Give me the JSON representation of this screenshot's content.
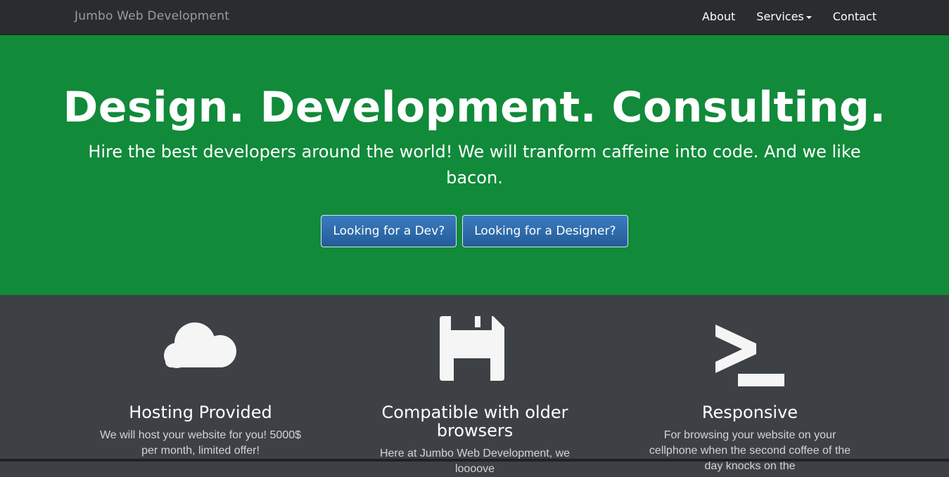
{
  "nav": {
    "brand": "Jumbo Web Development",
    "links": [
      {
        "label": "About"
      },
      {
        "label": "Services"
      },
      {
        "label": "Contact"
      }
    ]
  },
  "hero": {
    "title": "Design. Development. Consulting.",
    "subtitle": "Hire the best developers around the world! We will tranform caffeine into code. And we like bacon.",
    "buttons": [
      {
        "label": "Looking for a Dev?"
      },
      {
        "label": "Looking for a Designer?"
      }
    ]
  },
  "features": [
    {
      "icon": "cloud-icon",
      "title": "Hosting Provided",
      "text": "We will host your website for you! 5000$ per month, limited offer!"
    },
    {
      "icon": "floppy-disk-icon",
      "title": "Compatible with older browsers",
      "text": "Here at Jumbo Web Development, we loooove"
    },
    {
      "icon": "terminal-icon",
      "title": "Responsive",
      "text": "For browsing your website on your cellphone when the second coffee of the day knocks on the"
    }
  ],
  "colors": {
    "navbar": "#2b2c2e",
    "hero": "#118a3a",
    "button": "#2f6caa",
    "features": "#3d4145",
    "icon": "#f5f5f5"
  }
}
